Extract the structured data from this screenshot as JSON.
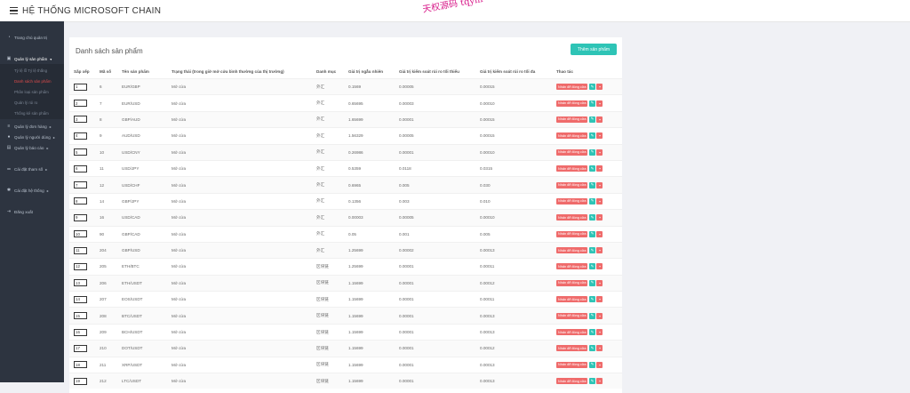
{
  "app": {
    "title": "HỆ THỐNG MICROSOFT CHAIN",
    "watermark": "天权源码 tqym"
  },
  "sidebar": {
    "items": [
      {
        "label": "Trang chủ quản trị",
        "icon": "gauge-icon"
      },
      {
        "label": "Quản lý sản phẩm",
        "icon": "box-icon",
        "expanded": true,
        "children": [
          "Tỷ lệ lỗ Tỷ lệ thắng",
          "Danh sách sản phẩm",
          "Phân loại sản phẩm",
          "Quản lý rủi ro",
          "Thống kê sản phẩm"
        ]
      },
      {
        "label": "Quản lý đơn hàng",
        "icon": "list-icon"
      },
      {
        "label": "Quản lý người dùng",
        "icon": "user-icon"
      },
      {
        "label": "Quản lý báo cáo",
        "icon": "chart-icon"
      },
      {
        "label": "Cài đặt tham số",
        "icon": "sliders-icon"
      },
      {
        "label": "Cài đặt hệ thống",
        "icon": "gear-icon"
      },
      {
        "label": "Đăng xuất",
        "icon": "logout-icon"
      }
    ]
  },
  "panel": {
    "title": "Danh sách sản phẩm",
    "add_label": "Thêm sản phẩm"
  },
  "table": {
    "headers": [
      "Sắp xếp",
      "Mã số",
      "Tên sản phẩm",
      "Trạng thái (trong giờ mở cửa bình thường của thị trường)",
      "Danh mục",
      "Giá trị ngẫu nhiên",
      "Giá trị kiểm soát rủi ro tối thiểu",
      "Giá trị kiểm soát rủi ro tối đa",
      "Thao tác"
    ],
    "action_label": "Nhấn để đóng cửa",
    "rows": [
      {
        "order": "1",
        "id": "6",
        "name": "EUR/GBP",
        "status": "Mở cửa",
        "category": "外汇",
        "random": "0.1569",
        "min": "0.00005",
        "max": "0.00015"
      },
      {
        "order": "2",
        "id": "7",
        "name": "EUR/USD",
        "status": "Mở cửa",
        "category": "外汇",
        "random": "0.65695",
        "min": "0.00003",
        "max": "0.00010"
      },
      {
        "order": "3",
        "id": "8",
        "name": "GBP/AUD",
        "status": "Mở cửa",
        "category": "外汇",
        "random": "1.65699",
        "min": "0.00001",
        "max": "0.00015"
      },
      {
        "order": "4",
        "id": "9",
        "name": "AUD/USD",
        "status": "Mở cửa",
        "category": "外汇",
        "random": "1.56329",
        "min": "0.00005",
        "max": "0.00015"
      },
      {
        "order": "5",
        "id": "10",
        "name": "USD/CNY",
        "status": "Mở cửa",
        "category": "外汇",
        "random": "0.26986",
        "min": "0.00001",
        "max": "0.00010"
      },
      {
        "order": "6",
        "id": "11",
        "name": "USD/JPY",
        "status": "Mở cửa",
        "category": "外汇",
        "random": "0.5359",
        "min": "0.0118",
        "max": "0.0315"
      },
      {
        "order": "7",
        "id": "12",
        "name": "USD/CHF",
        "status": "Mở cửa",
        "category": "外汇",
        "random": "0.6965",
        "min": "0.005",
        "max": "0.030"
      },
      {
        "order": "8",
        "id": "14",
        "name": "GBP/JPY",
        "status": "Mở cửa",
        "category": "外汇",
        "random": "0.1356",
        "min": "0.003",
        "max": "0.010"
      },
      {
        "order": "9",
        "id": "16",
        "name": "USD/CAD",
        "status": "Mở cửa",
        "category": "外汇",
        "random": "0.00003",
        "min": "0.00005",
        "max": "0.00010"
      },
      {
        "order": "10",
        "id": "90",
        "name": "GBP/CAD",
        "status": "Mở cửa",
        "category": "外汇",
        "random": "0.05",
        "min": "0.001",
        "max": "0.005"
      },
      {
        "order": "11",
        "id": "204",
        "name": "GBP/USD",
        "status": "Mở cửa",
        "category": "外汇",
        "random": "1.25699",
        "min": "0.00002",
        "max": "0.00013"
      },
      {
        "order": "12",
        "id": "205",
        "name": "ETH/BTC",
        "status": "Mở cửa",
        "category": "区块链",
        "random": "1.25699",
        "min": "0.00001",
        "max": "0.00011"
      },
      {
        "order": "13",
        "id": "206",
        "name": "ETH/USDT",
        "status": "Mở cửa",
        "category": "区块链",
        "random": "1.15699",
        "min": "0.00001",
        "max": "0.00012"
      },
      {
        "order": "14",
        "id": "207",
        "name": "EOS/USDT",
        "status": "Mở cửa",
        "category": "区块链",
        "random": "1.15699",
        "min": "0.00001",
        "max": "0.00011"
      },
      {
        "order": "15",
        "id": "208",
        "name": "BTC/USDT",
        "status": "Mở cửa",
        "category": "区块链",
        "random": "1.15699",
        "min": "0.00001",
        "max": "0.00013"
      },
      {
        "order": "16",
        "id": "209",
        "name": "BCH/USDT",
        "status": "Mở cửa",
        "category": "区块链",
        "random": "1.15699",
        "min": "0.00001",
        "max": "0.00013"
      },
      {
        "order": "17",
        "id": "210",
        "name": "DOT/USDT",
        "status": "Mở cửa",
        "category": "区块链",
        "random": "1.15699",
        "min": "0.00001",
        "max": "0.00012"
      },
      {
        "order": "18",
        "id": "211",
        "name": "XRP/USDT",
        "status": "Mở cửa",
        "category": "区块链",
        "random": "1.15699",
        "min": "0.00001",
        "max": "0.00013"
      },
      {
        "order": "19",
        "id": "212",
        "name": "LTC/USDT",
        "status": "Mở cửa",
        "category": "区块链",
        "random": "1.15699",
        "min": "0.00001",
        "max": "0.00013"
      }
    ]
  },
  "colors": {
    "sidebar_bg": "#2d3440",
    "accent_teal": "#2ec4b6",
    "accent_red": "#ef6b6b",
    "active_link": "#e04b4b"
  }
}
